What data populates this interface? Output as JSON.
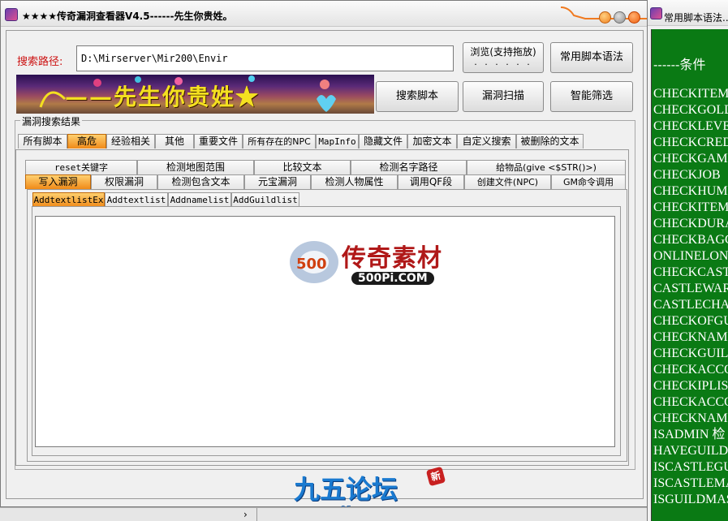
{
  "main_window": {
    "title": "★★★★传奇漏洞查看器V4.5------先生你贵姓。",
    "search_label": "搜索路径:",
    "search_path_value": "D:\\Mirserver\\Mir200\\Envir",
    "browse_button": "浏览(支持拖放)",
    "browse_dots": "· · · · · ·",
    "syntax_button": "常用脚本语法",
    "search_script_button": "搜索脚本",
    "vuln_scan_button": "漏洞扫描",
    "smart_filter_button": "智能筛选",
    "banner_text": "——先生你贵姓★",
    "results_group_label": "漏洞搜索结果",
    "tabs_level1": [
      "所有脚本",
      "高危",
      "经验相关",
      "其他",
      "重要文件",
      "所有存在的NPC",
      "MapInfo",
      "隐藏文件",
      "加密文本",
      "自定义搜索",
      "被删除的文本"
    ],
    "tabs_level2_row1": [
      "reset关键字",
      "检测地图范围",
      "比较文本",
      "检测名字路径",
      "给物品(give <$STR()>)"
    ],
    "tabs_level2_row2": [
      "写入漏洞",
      "权限漏洞",
      "检测包含文本",
      "元宝漏洞",
      "检测人物属性",
      "调用QF段",
      "创建文件(NPC)",
      "GM命令调用"
    ],
    "tabs_level3": [
      "AddtextlistEx",
      "Addtextlist",
      "Addnamelist",
      "AddGuildlist"
    ],
    "watermark_text": "传奇素材",
    "watermark_site": "500Pi.COM",
    "footer_logo_text": "九五论坛",
    "footer_logo_url": "www.95gm.com",
    "footer_badge": "新",
    "bg_arrow": "›"
  },
  "syntax_window": {
    "title": "常用脚本语法...",
    "header": "------条件",
    "items": [
      "CHECKITEM 检",
      "CHECKGOLD",
      "CHECKLEVEL",
      "CHECKCREDIT",
      "CHECKGAMEG",
      "CHECKJOB",
      "CHECKHUM 地",
      "CHECKITEMW",
      "CHECKDURA",
      "CHECKBAGGA",
      "ONLINELONG",
      "CHECKCASTL",
      "CASTLEWARA",
      "CASTLECHAN",
      "CHECKOFGUI",
      "CHECKNAMEI",
      "CHECKGUILI",
      "CHECKACCOU",
      "CHECKIPLIS",
      "CHECKACCOU",
      "CHECKNAMEL",
      "ISADMIN 检",
      "HAVEGUILD",
      "ISCASTLEGU",
      "ISCASTLEMA",
      "ISGUILDMAS"
    ]
  },
  "colors": {
    "active_tab": "#f08a18",
    "syntax_bg": "#0a7a14",
    "label_red": "#cc1111",
    "banner_text": "#f4e020"
  },
  "state": {
    "active_tab_level1": "高危",
    "active_tab_level2": "写入漏洞",
    "active_tab_level3": "AddtextlistEx"
  }
}
